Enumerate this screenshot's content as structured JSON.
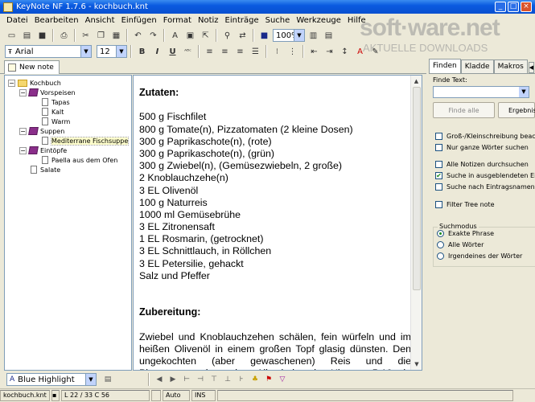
{
  "window": {
    "title": "KeyNote NF 1.7.6 - kochbuch.knt"
  },
  "watermark": {
    "brand": "soft·ware.net",
    "tagline": "AKTUELLE DOWNLOADS"
  },
  "menu": [
    "Datei",
    "Bearbeiten",
    "Ansicht",
    "Einfügen",
    "Format",
    "Notiz",
    "Einträge",
    "Suche",
    "Werkzeuge",
    "Hilfe"
  ],
  "toolbar": {
    "zoom": "100%",
    "font_name": "Arial",
    "font_size": "12"
  },
  "tabs": {
    "note_tab": "New note"
  },
  "tree": {
    "root": "Kochbuch",
    "vorspeisen": "Vorspeisen",
    "tapas": "Tapas",
    "kalt": "Kalt",
    "warm": "Warm",
    "suppen": "Suppen",
    "fischsuppe": "Mediterrane Fischsuppe",
    "eintoepfe": "Eintöpfe",
    "paella": "Paella aus dem Ofen",
    "salate": "Salate"
  },
  "editor": {
    "heading1": "Zutaten:",
    "ingredients": [
      "500 g Fischfilet",
      "800 g Tomate(n), Pizzatomaten (2 kleine Dosen)",
      "300 g Paprikaschote(n), (rote)",
      "300 g Paprikaschote(n), (grün)",
      "300 g Zwiebel(n), (Gemüsezwiebeln, 2 große)",
      "2  Knoblauchzehe(n)",
      "3 EL Olivenöl",
      "100 g Naturreis",
      "1000 ml Gemüsebrühe",
      "3 EL Zitronensaft",
      "1 EL Rosmarin, (getrocknet)",
      "3 EL Schnittlauch, in Röllchen",
      "3 EL Petersilie, gehackt",
      "Salz und Pfeffer"
    ],
    "heading2": "Zubereitung:",
    "preparation": "Zwiebel und Knoblauchzehen schälen, fein würfeln und im heißen Olivenöl in einem großen Topf glasig dünsten. Den ungekochten (aber gewaschenen) Reis und die Pizzatomaten dazugeben. Alles bei starker Hitze ca. 5-10 min schmoren lassen. Die"
  },
  "right_panel": {
    "tabs": [
      "Finden",
      "Kladde",
      "Makros"
    ],
    "find_label": "Finde Text:",
    "find_all_button": "Finde alle",
    "results_button": "Ergebnis",
    "options": [
      {
        "label": "Groß-/Kleinschreibung beach",
        "checked": false
      },
      {
        "label": "Nur ganze Wörter suchen",
        "checked": false
      },
      {
        "label": "Alle Notizen durchsuchen",
        "checked": false
      },
      {
        "label": "Suche in ausgeblendeten Ein",
        "checked": true
      },
      {
        "label": "Suche nach Eintragsnamen",
        "checked": false
      },
      {
        "label": "Filter Tree note",
        "checked": false
      }
    ],
    "search_mode_title": "Suchmodus",
    "search_modes": [
      {
        "label": "Exakte Phrase",
        "selected": true
      },
      {
        "label": "Alle Wörter",
        "selected": false
      },
      {
        "label": "Irgendeines der Wörter",
        "selected": false
      }
    ]
  },
  "bottom_toolbar": {
    "style": "Blue Highlight"
  },
  "status": {
    "file": "kochbuch.knt",
    "position": "L 22 / 33  C 56",
    "mode": "Auto",
    "insert": "INS"
  },
  "colors": {
    "title_bar": "#0a5ae0",
    "face": "#ece9d8",
    "book_icon": "#8a2e8a",
    "check_green": "#1a8a1a"
  }
}
